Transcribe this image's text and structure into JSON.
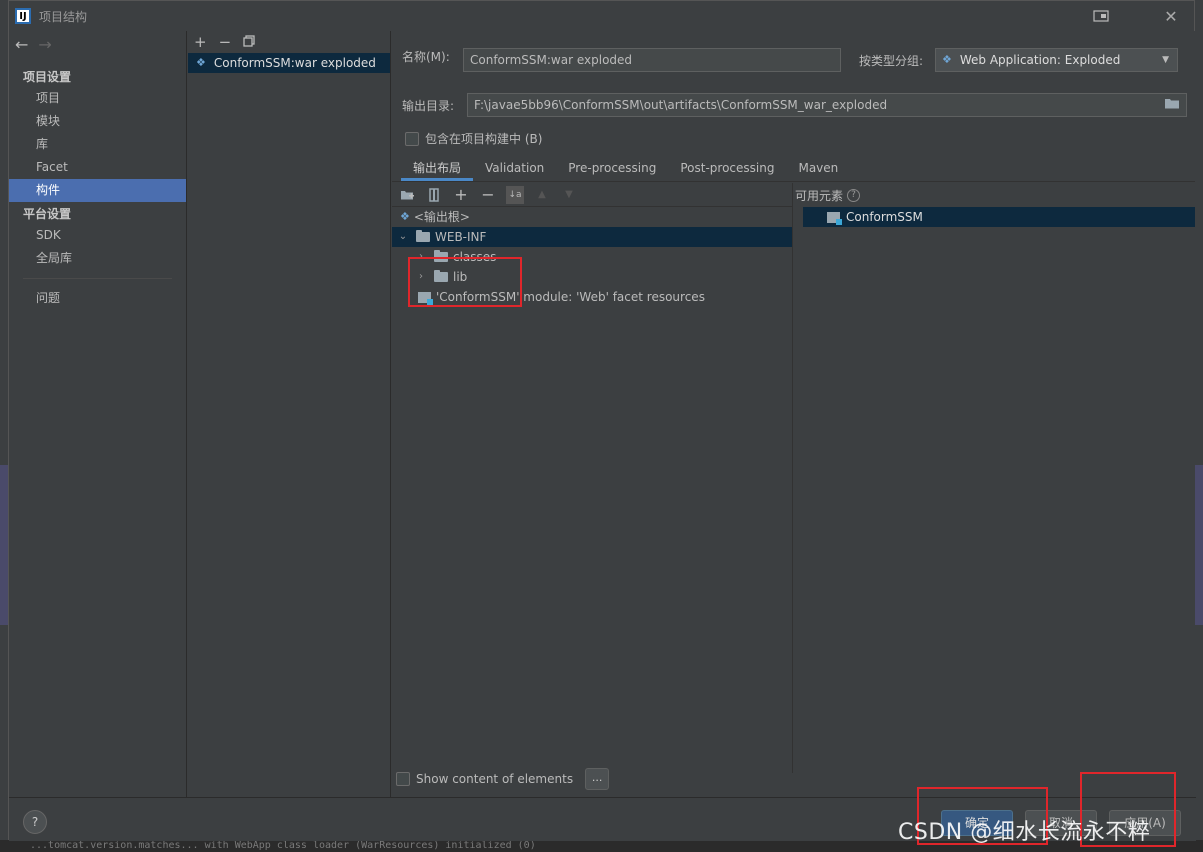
{
  "window": {
    "title": "项目结构"
  },
  "nav": {
    "sections": [
      {
        "title": "项目设置",
        "items": [
          "项目",
          "模块",
          "库",
          "Facet",
          "构件"
        ]
      },
      {
        "title": "平台设置",
        "items": [
          "SDK",
          "全局库"
        ]
      }
    ],
    "extra_items": [
      "问题"
    ],
    "selected": "构件"
  },
  "artifacts": {
    "items": [
      "ConformSSM:war exploded"
    ]
  },
  "form": {
    "name_label": "名称(M):",
    "name_value": "ConformSSM:war exploded",
    "type_label": "按类型分组:",
    "type_value": "Web Application: Exploded",
    "output_label": "输出目录:",
    "output_value": "F:\\javae5bb96\\ConformSSM\\out\\artifacts\\ConformSSM_war_exploded",
    "include_label": "包含在项目构建中 (B)"
  },
  "tabs": [
    "输出布局",
    "Validation",
    "Pre-processing",
    "Post-processing",
    "Maven"
  ],
  "tree": {
    "root": "<输出根>",
    "webinf": "WEB-INF",
    "classes": "classes",
    "lib": "lib",
    "facet": "'ConformSSM' module: 'Web' facet resources"
  },
  "available": {
    "title": "可用元素",
    "items": [
      "ConformSSM"
    ]
  },
  "footer": {
    "show_content": "Show content of elements",
    "dots": "...",
    "ok": "确定",
    "cancel": "取消",
    "apply": "应用(A)"
  },
  "watermark": "CSDN @细水长流永不粹",
  "background": {
    "bottom_text": "...tomcat.version.matches... with WebApp class loader (WarResources) initialized (0)"
  }
}
